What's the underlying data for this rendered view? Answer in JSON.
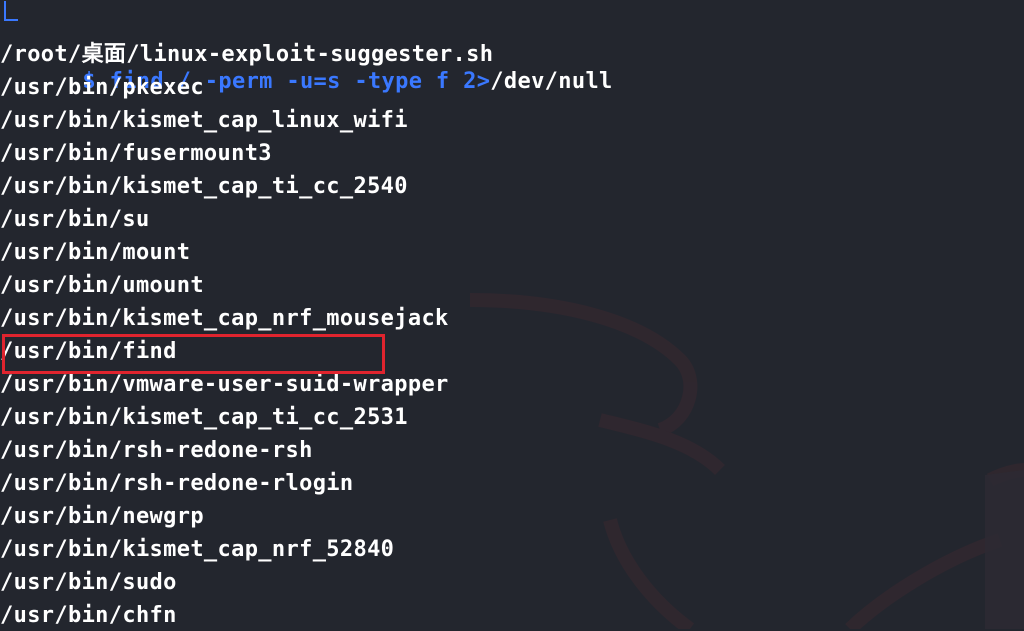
{
  "prompt": {
    "dollar": "$",
    "command": "find",
    "args": " / -perm -u=s -type f ",
    "redirect": "2>",
    "redirect_target": "/dev/null"
  },
  "output_lines": [
    "/root/桌面/linux-exploit-suggester.sh",
    "/usr/bin/pkexec",
    "/usr/bin/kismet_cap_linux_wifi",
    "/usr/bin/fusermount3",
    "/usr/bin/kismet_cap_ti_cc_2540",
    "/usr/bin/su",
    "/usr/bin/mount",
    "/usr/bin/umount",
    "/usr/bin/kismet_cap_nrf_mousejack",
    "/usr/bin/find",
    "/usr/bin/vmware-user-suid-wrapper",
    "/usr/bin/kismet_cap_ti_cc_2531",
    "/usr/bin/rsh-redone-rsh",
    "/usr/bin/rsh-redone-rlogin",
    "/usr/bin/newgrp",
    "/usr/bin/kismet_cap_nrf_52840",
    "/usr/bin/sudo",
    "/usr/bin/chfn"
  ],
  "highlighted_line": "/usr/bin/find",
  "colors": {
    "background": "#23262e",
    "prompt_accent": "#3a78ff",
    "text": "#ffffff",
    "highlight_box": "#e0242e"
  }
}
